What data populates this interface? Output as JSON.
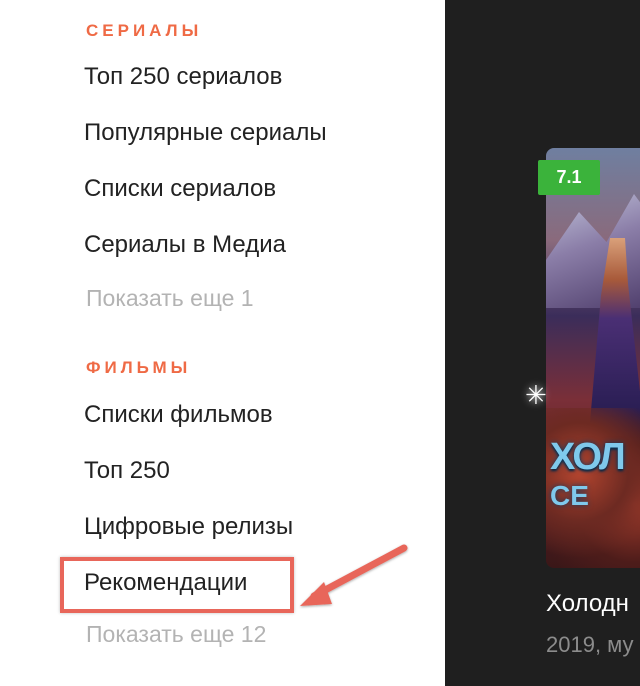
{
  "series_section": {
    "title": "СЕРИАЛЫ",
    "items": [
      {
        "label": "Топ 250 сериалов"
      },
      {
        "label": "Популярные сериалы"
      },
      {
        "label": "Списки сериалов"
      },
      {
        "label": "Сериалы в Медиа"
      }
    ],
    "more_label": "Показать еще 1"
  },
  "films_section": {
    "title": "ФИЛЬМЫ",
    "items": [
      {
        "label": "Списки фильмов"
      },
      {
        "label": "Топ 250"
      },
      {
        "label": "Цифровые релизы"
      },
      {
        "label": "Рекомендации",
        "highlighted": true
      }
    ],
    "more_label": "Показать еще 12"
  },
  "movie_card": {
    "rating": "7.1",
    "poster_title": "ХОЛ",
    "poster_subtitle": "СЕ",
    "title": "Холодн",
    "meta": "2019, му",
    "rating_color": "#3bb33b"
  },
  "colors": {
    "accent": "#ef6a45",
    "highlight": "#e8665a",
    "dark_bg": "#1f1f1f"
  },
  "icons": {
    "sparkle": "sparkle-icon",
    "arrow": "pointer-arrow-annotation"
  }
}
